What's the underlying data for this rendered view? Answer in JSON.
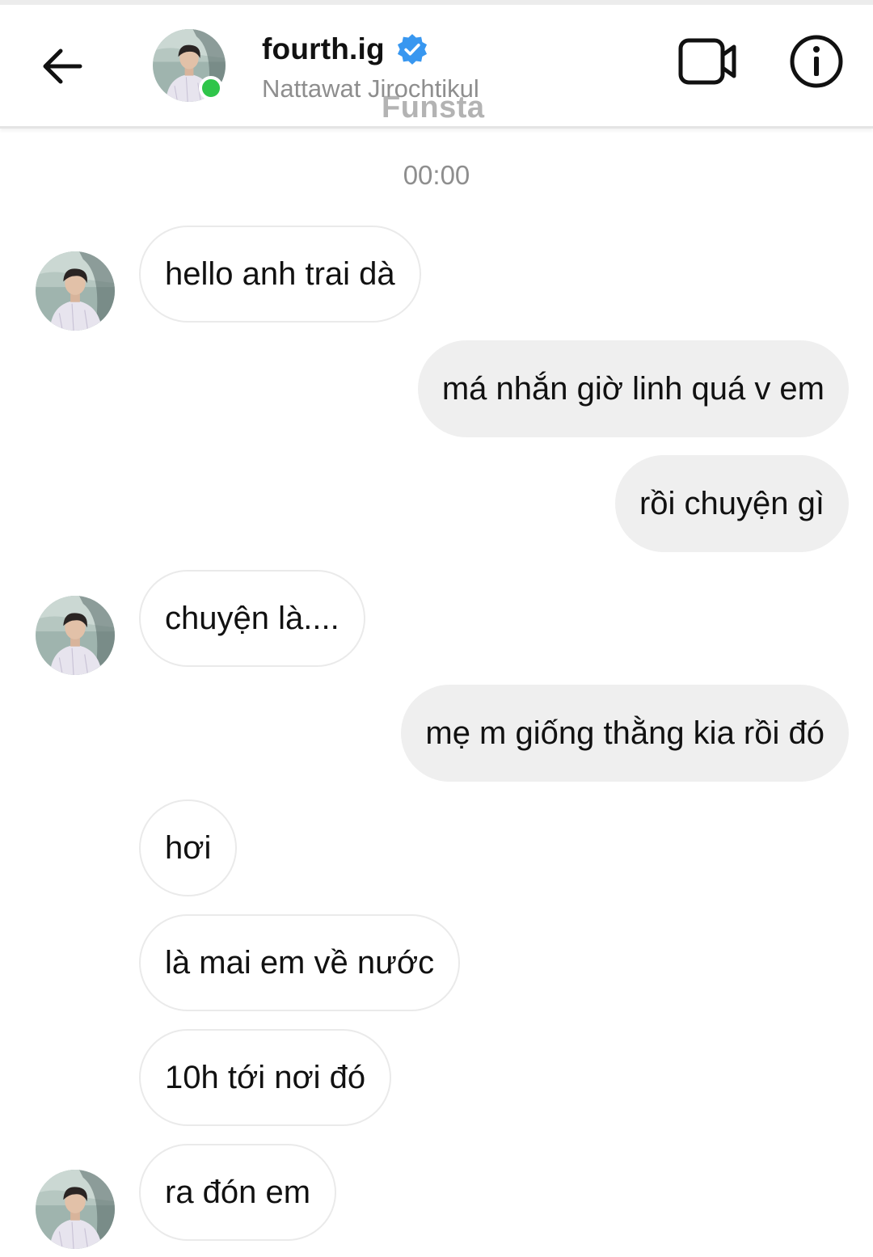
{
  "header": {
    "username": "fourth.ig",
    "full_name": "Nattawat Jirochtikul",
    "watermark": "Funsta",
    "verified": true,
    "online": true,
    "icons": {
      "back": "arrow-left-icon",
      "video": "video-call-icon",
      "info": "info-icon",
      "verified": "verified-badge-icon"
    }
  },
  "conversation": {
    "timestamp": "00:00",
    "messages": [
      {
        "side": "incoming",
        "text": "hello anh trai dà"
      },
      {
        "side": "outgoing",
        "text": "má nhắn giờ linh quá v em"
      },
      {
        "side": "outgoing",
        "text": "rồi chuyện gì"
      },
      {
        "side": "incoming",
        "text": "chuyện là...."
      },
      {
        "side": "outgoing",
        "text": "mẹ m giống thằng kia rồi đó"
      },
      {
        "side": "incoming",
        "text": "hơi"
      },
      {
        "side": "incoming",
        "text": "là mai em về nước"
      },
      {
        "side": "incoming",
        "text": "10h tới nơi đó"
      },
      {
        "side": "incoming",
        "text": "ra đón em"
      }
    ]
  },
  "colors": {
    "online": "#2fc54a",
    "verified": "#3897f0",
    "incoming_bubble": "#ffffff",
    "outgoing_bubble": "#efefef",
    "muted_text": "#8e8e8e"
  }
}
